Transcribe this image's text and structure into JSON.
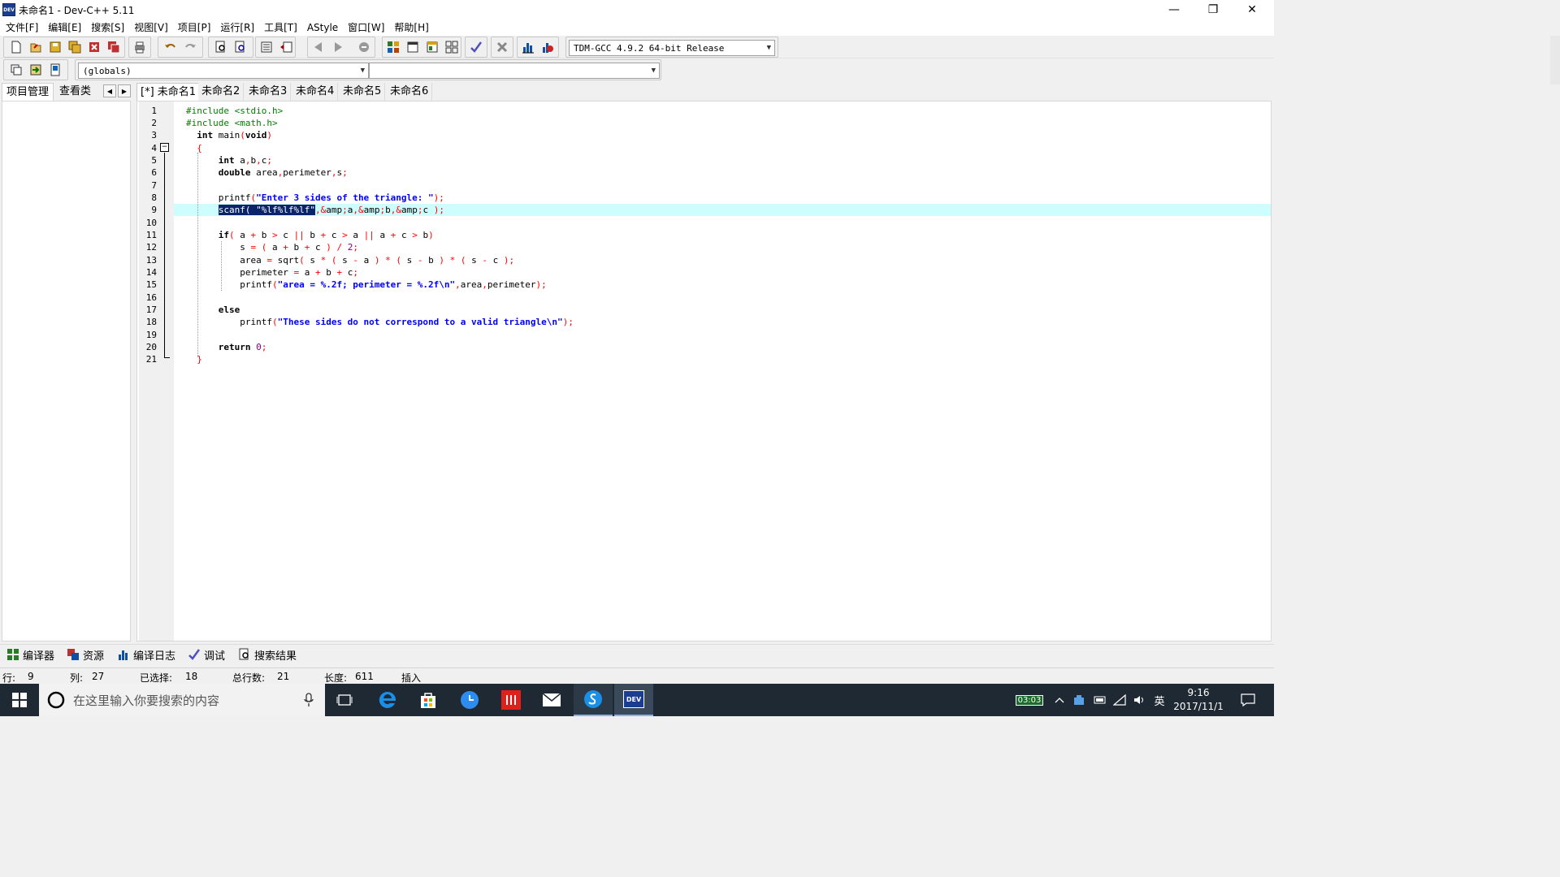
{
  "window": {
    "title": "未命名1 - Dev-C++ 5.11",
    "app_icon_text": "DEV",
    "minimize": "—",
    "restore": "❐",
    "close": "✕"
  },
  "menu": [
    "文件[F]",
    "编辑[E]",
    "搜索[S]",
    "视图[V]",
    "项目[P]",
    "运行[R]",
    "工具[T]",
    "AStyle",
    "窗口[W]",
    "帮助[H]"
  ],
  "compiler_select": "TDM-GCC 4.9.2 64-bit Release",
  "scope_select": "(globals)",
  "function_select": "",
  "left_panel": {
    "tabs": [
      "项目管理",
      "查看类"
    ],
    "nav_prev": "◀",
    "nav_next": "▶"
  },
  "editor_tabs": [
    "[*] 未命名1",
    "未命名2",
    "未命名3",
    "未命名4",
    "未命名5",
    "未命名6"
  ],
  "code_lines": [
    "#include <stdio.h>",
    "#include <math.h>",
    "  int main(void)",
    "  {",
    "      int a,b,c;",
    "      double area,perimeter,s;",
    "",
    "      printf(\"Enter 3 sides of the triangle: \");",
    "      scanf( \"%lf%lf%lf\",&a,&b,&c );",
    "",
    "      if( a + b > c || b + c > a || a + c > b)",
    "          s = ( a + b + c ) / 2;",
    "          area = sqrt( s * ( s - a ) * ( s - b ) * ( s - c );",
    "          perimeter = a + b + c;",
    "          printf(\"area = %.2f; perimeter = %.2f\\n\",area,perimeter);",
    "",
    "      else",
    "          printf(\"These sides do not correspond to a valid triangle\\n\");",
    "",
    "      return 0;",
    "  }"
  ],
  "line_numbers": [
    "1",
    "2",
    "3",
    "4",
    "5",
    "6",
    "7",
    "8",
    "9",
    "10",
    "11",
    "12",
    "13",
    "14",
    "15",
    "16",
    "17",
    "18",
    "19",
    "20",
    "21"
  ],
  "fold_marker": "−",
  "bottom_tabs": [
    "编译器",
    "资源",
    "编译日志",
    "调试",
    "搜索结果"
  ],
  "status": {
    "row_label": "行:",
    "row_value": "9",
    "col_label": "列:",
    "col_value": "27",
    "selected_label": "已选择:",
    "selected_value": "18",
    "total_label": "总行数:",
    "total_value": "21",
    "length_label": "长度:",
    "length_value": "611",
    "mode": "插入"
  },
  "taskbar": {
    "search_placeholder": "在这里输入你要搜索的内容",
    "battery_time": "03:03",
    "ime": "英",
    "time": "9:16",
    "date": "2017/11/1",
    "devcpp_icon_text": "DEV"
  },
  "colors": {
    "selection": "#0a246a",
    "current_line": "#cdfdfd",
    "preprocessor": "#008000",
    "string": "#0000ff",
    "operator": "#ff0000",
    "taskbar": "#1f2933"
  }
}
